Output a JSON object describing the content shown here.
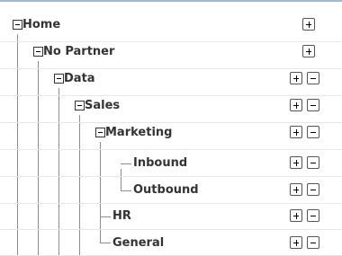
{
  "tree": {
    "nodes": [
      {
        "id": "home",
        "label": "Home",
        "expander": "minus",
        "actions": [
          "add"
        ]
      },
      {
        "id": "no-partner",
        "label": "No Partner",
        "expander": "minus",
        "actions": [
          "add"
        ]
      },
      {
        "id": "data",
        "label": "Data",
        "expander": "minus",
        "actions": [
          "add",
          "remove"
        ]
      },
      {
        "id": "sales",
        "label": "Sales",
        "expander": "minus",
        "actions": [
          "add",
          "remove"
        ]
      },
      {
        "id": "marketing",
        "label": "Marketing",
        "expander": "minus",
        "actions": [
          "add",
          "remove"
        ]
      },
      {
        "id": "inbound",
        "label": "Inbound",
        "expander": null,
        "actions": [
          "add",
          "remove"
        ]
      },
      {
        "id": "outbound",
        "label": "Outbound",
        "expander": null,
        "actions": [
          "add",
          "remove"
        ]
      },
      {
        "id": "hr",
        "label": "HR",
        "expander": null,
        "actions": [
          "add",
          "remove"
        ]
      },
      {
        "id": "general",
        "label": "General",
        "expander": null,
        "actions": [
          "add",
          "remove"
        ]
      }
    ]
  },
  "icons": {
    "expander": "collapse-minus-box-icon",
    "add": "plus-box-icon",
    "remove": "minus-box-icon"
  },
  "colors": {
    "header_border": "#9fb9cf",
    "text": "#333333",
    "tree_line": "#8c8c8c",
    "row_divider": "#e3e6ea"
  }
}
